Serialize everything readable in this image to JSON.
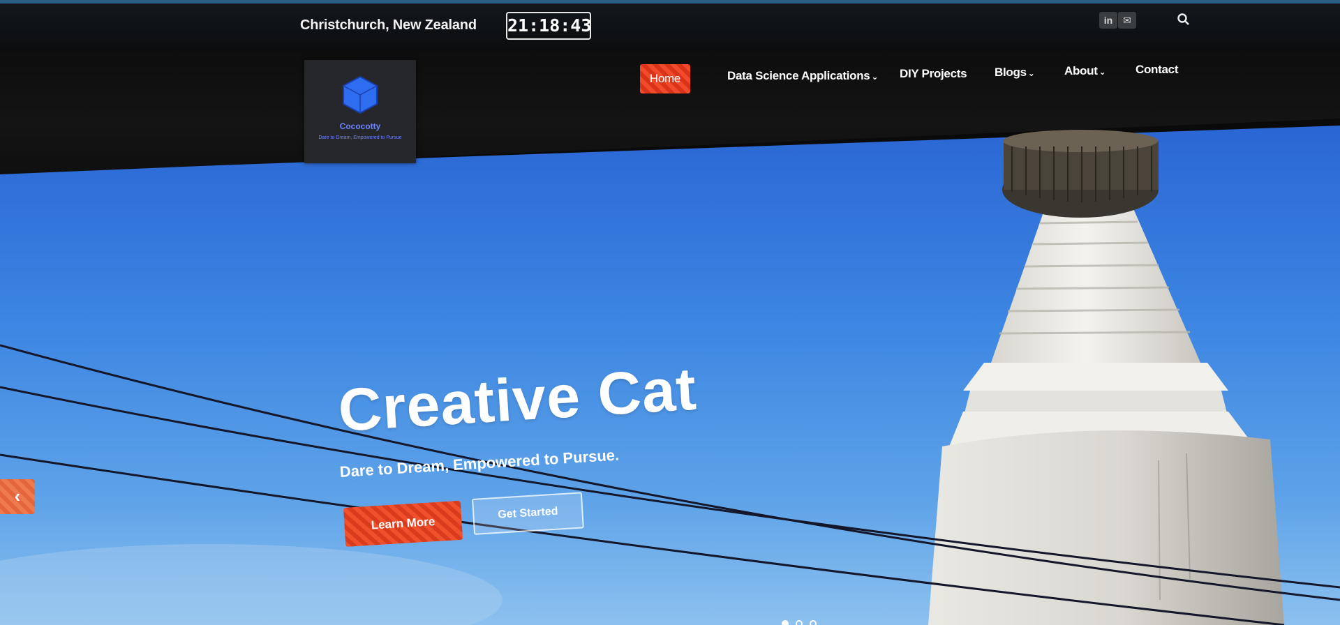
{
  "topbar": {
    "location": "Christchurch, New Zealand",
    "clock": "21:18:43",
    "social": [
      {
        "icon": "linkedin-icon",
        "label": "in"
      },
      {
        "icon": "mail-icon",
        "label": "✉"
      }
    ],
    "search_icon": "search-icon"
  },
  "logo": {
    "name": "Cococotty",
    "tagline": "Dare to Dream, Empowered to Pursue",
    "color": "#6d83ff"
  },
  "nav": {
    "items": [
      {
        "label": "Home",
        "active": true
      },
      {
        "label": "Data Science Applications",
        "dropdown": true
      },
      {
        "label": "DIY Projects",
        "dropdown": false
      },
      {
        "label": "Blogs",
        "dropdown": true
      },
      {
        "label": "About",
        "dropdown": true
      },
      {
        "label": "Contact",
        "dropdown": false
      }
    ],
    "caret": "⌄",
    "accent": "#f24a2a"
  },
  "hero": {
    "title": "Creative Cat",
    "subtitle": "Dare to Dream, Empowered to Pursue.",
    "primary_button": "Learn More",
    "secondary_button": "Get Started",
    "prev_arrow": "‹",
    "slide_count": 3,
    "active_slide": 1
  }
}
